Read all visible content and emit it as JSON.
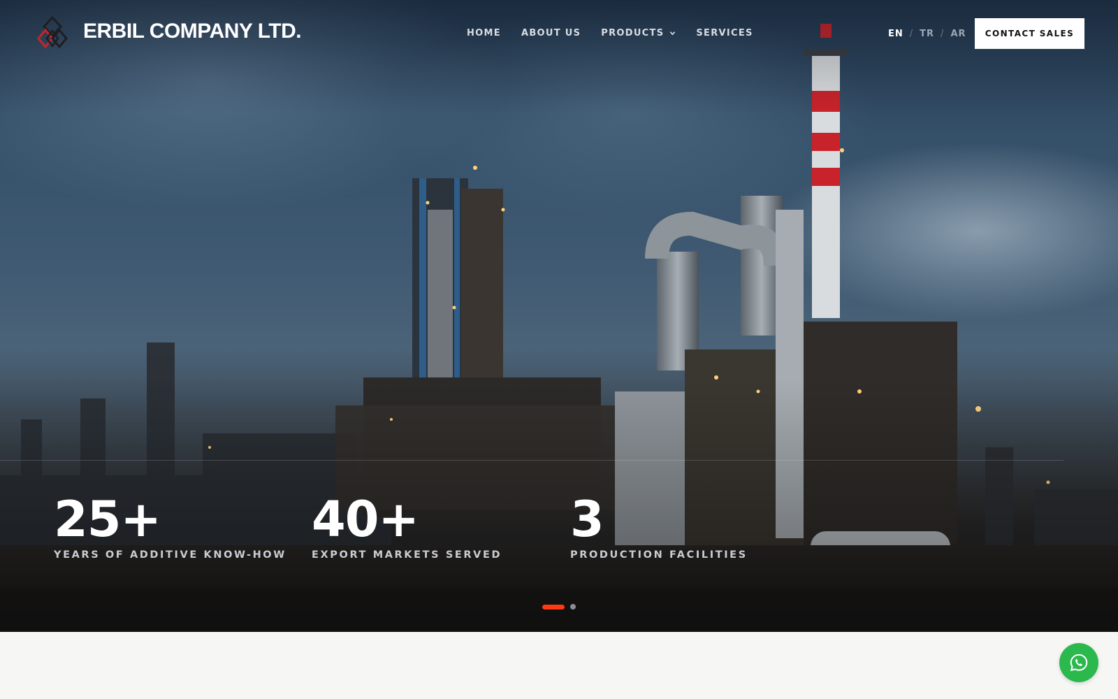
{
  "header": {
    "brand": "ERBIL COMPANY LTD.",
    "nav": [
      {
        "label": "HOME"
      },
      {
        "label": "ABOUT US"
      },
      {
        "label": "PRODUCTS",
        "has_dropdown": true
      },
      {
        "label": "SERVICES"
      }
    ],
    "languages": [
      {
        "code": "EN",
        "active": true
      },
      {
        "code": "TR",
        "active": false
      },
      {
        "code": "AR",
        "active": false
      }
    ],
    "language_separator": "/",
    "cta_label": "CONTACT SALES"
  },
  "hero": {
    "stats": [
      {
        "value": "25+",
        "label": "YEARS OF ADDITIVE KNOW-HOW"
      },
      {
        "value": "40+",
        "label": "EXPORT MARKETS SERVED"
      },
      {
        "value": "3",
        "label": "PRODUCTION FACILITIES"
      }
    ],
    "slider": {
      "total": 2,
      "active_index": 0
    }
  },
  "icons": {
    "logo": "diamond-logo-icon",
    "dropdown": "chevron-down-icon",
    "chat": "whatsapp-icon"
  },
  "colors": {
    "accent": "#ff3b12",
    "whatsapp": "#2bb84d",
    "cta_bg": "#ffffff",
    "page_bg": "#f6f6f4"
  }
}
